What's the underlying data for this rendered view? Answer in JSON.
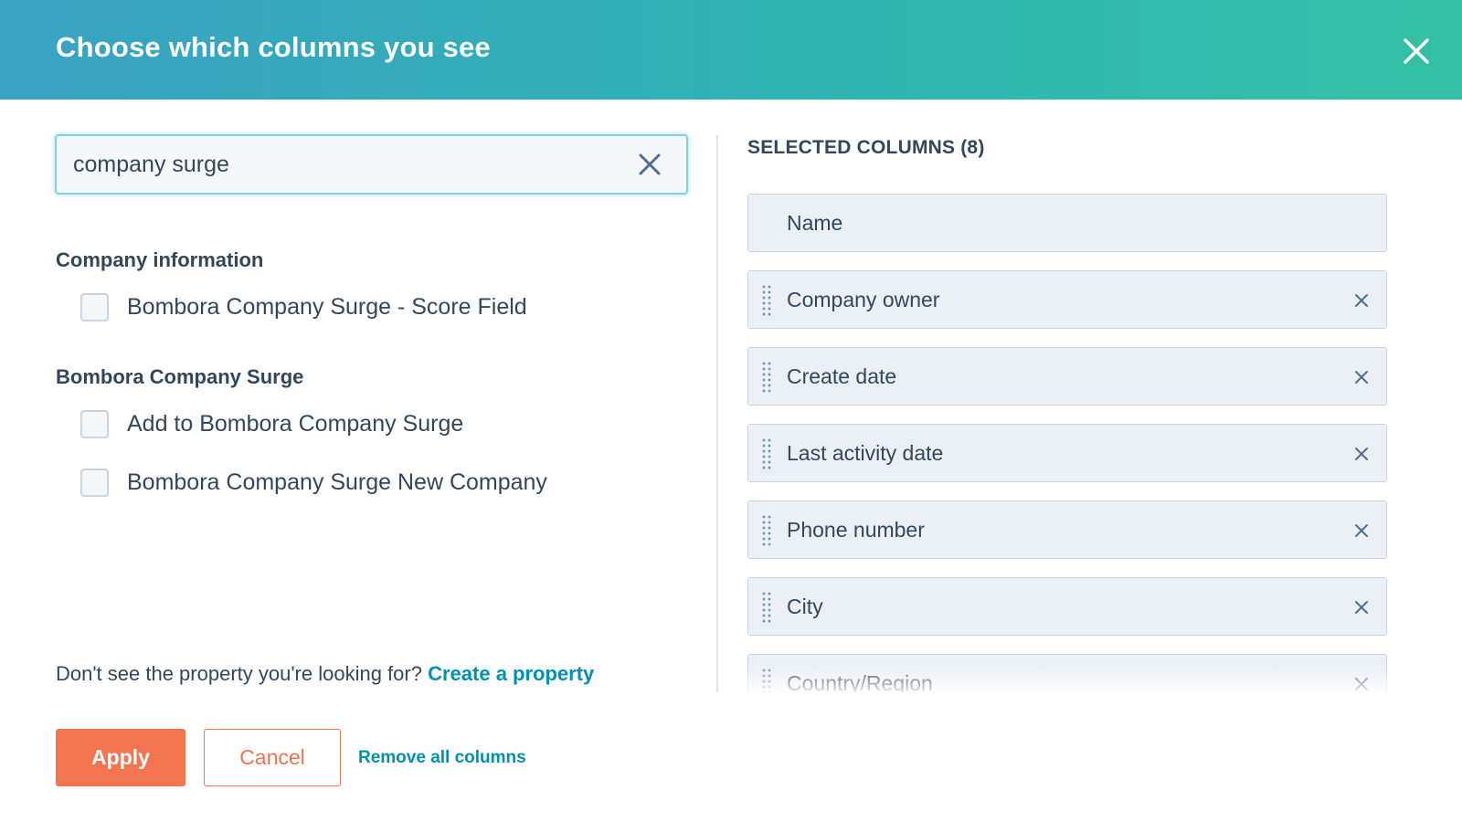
{
  "dialog": {
    "title": "Choose which columns you see"
  },
  "search": {
    "value": "company surge"
  },
  "groups": [
    {
      "title": "Company information",
      "items": [
        {
          "label": "Bombora Company Surge - Score Field",
          "checked": false
        }
      ]
    },
    {
      "title": "Bombora Company Surge",
      "items": [
        {
          "label": "Add to Bombora Company Surge",
          "checked": false
        },
        {
          "label": "Bombora Company Surge New Company",
          "checked": false
        }
      ]
    }
  ],
  "footer_note": {
    "text": "Don't see the property you're looking for?",
    "link": "Create a property"
  },
  "selected": {
    "heading": "SELECTED COLUMNS (8)",
    "columns": [
      "Name",
      "Company owner",
      "Create date",
      "Last activity date",
      "Phone number",
      "City",
      "Country/Region"
    ]
  },
  "actions": {
    "apply": "Apply",
    "cancel": "Cancel",
    "remove_all": "Remove all columns"
  },
  "colors": {
    "header_gradient_start": "#3aa2c2",
    "header_gradient_end": "#35c0a4",
    "primary_button": "#f2754f",
    "link": "#0091ae",
    "text": "#33475b"
  },
  "icons": {
    "close": "close-icon",
    "search_clear": "clear-icon",
    "drag": "drag-handle-icon",
    "remove": "remove-icon"
  }
}
